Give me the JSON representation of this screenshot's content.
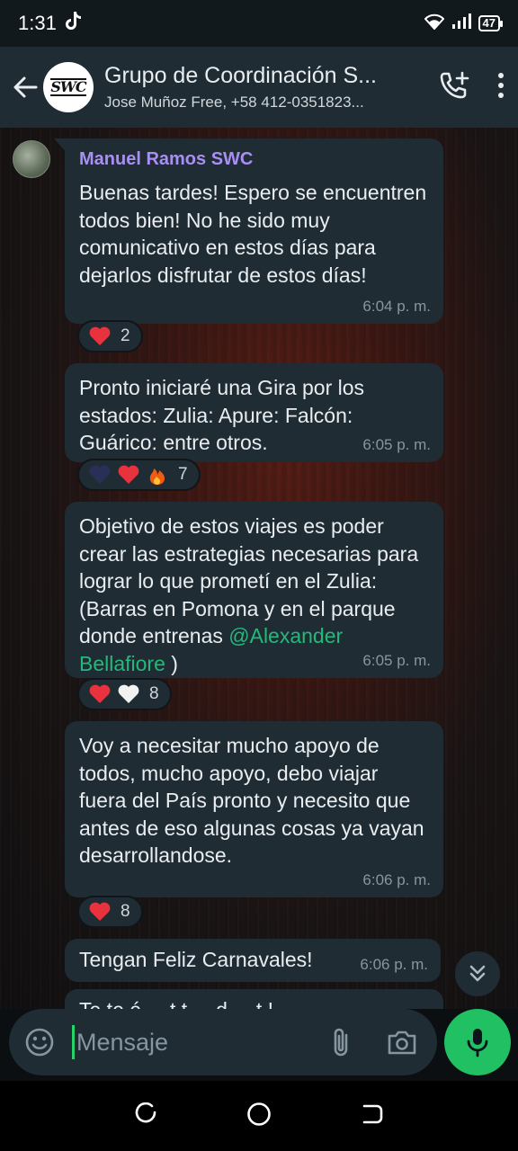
{
  "status_bar": {
    "time": "1:31",
    "battery": "47",
    "icons": [
      "tiktok-icon",
      "wifi-icon",
      "signal-icon",
      "battery-icon"
    ]
  },
  "header": {
    "title": "Grupo de Coordinación S...",
    "subtitle": "Jose Muñoz Free, +58 412-0351823...",
    "avatar_text": "SWC"
  },
  "messages": [
    {
      "sender": "Manuel Ramos SWC",
      "text": "Buenas tardes! Espero se encuentren todos bien! No he sido muy comunicativo en estos días para dejarlos disfrutar de estos días!",
      "time": "6:04 p. m.",
      "reactions": {
        "emojis": [
          "red-heart"
        ],
        "count": "2"
      }
    },
    {
      "text": "Pronto iniciaré una Gira por los estados: Zulia: Apure: Falcón: Guárico: entre otros.",
      "time": "6:05 p. m.",
      "reactions": {
        "emojis": [
          "navy-heart",
          "red-heart",
          "fire"
        ],
        "count": "7"
      }
    },
    {
      "text_before_mention": "Objetivo de estos viajes es poder crear las estrategias necesarias para lograr lo que prometí en el Zulia: (Barras en Pomona y en el parque donde entrenas ",
      "mention": "@Alexander Bellafiore",
      "text_after_mention": " )",
      "time": "6:05 p. m.",
      "reactions": {
        "emojis": [
          "red-heart",
          "white-heart"
        ],
        "count": "8"
      }
    },
    {
      "text": "Voy a necesitar mucho apoyo de todos, mucho apoyo, debo viajar fuera del País pronto y necesito que antes de eso algunas cosas ya vayan desarrollandose.",
      "time": "6:06 p. m.",
      "reactions": {
        "emojis": [
          "red-heart"
        ],
        "count": "8"
      }
    },
    {
      "text": "Tengan Feliz Carnavales!",
      "time": "6:06 p. m."
    },
    {
      "text": "Te te é ... t t ... d ... t !"
    }
  ],
  "composer": {
    "placeholder": "Mensaje"
  },
  "colors": {
    "bubble": "#1f2c34",
    "header": "#1f2c34",
    "sender_name": "#a98ff5",
    "mention": "#25b87a",
    "mic_button": "#21c063",
    "timestamp": "#8696a0"
  }
}
